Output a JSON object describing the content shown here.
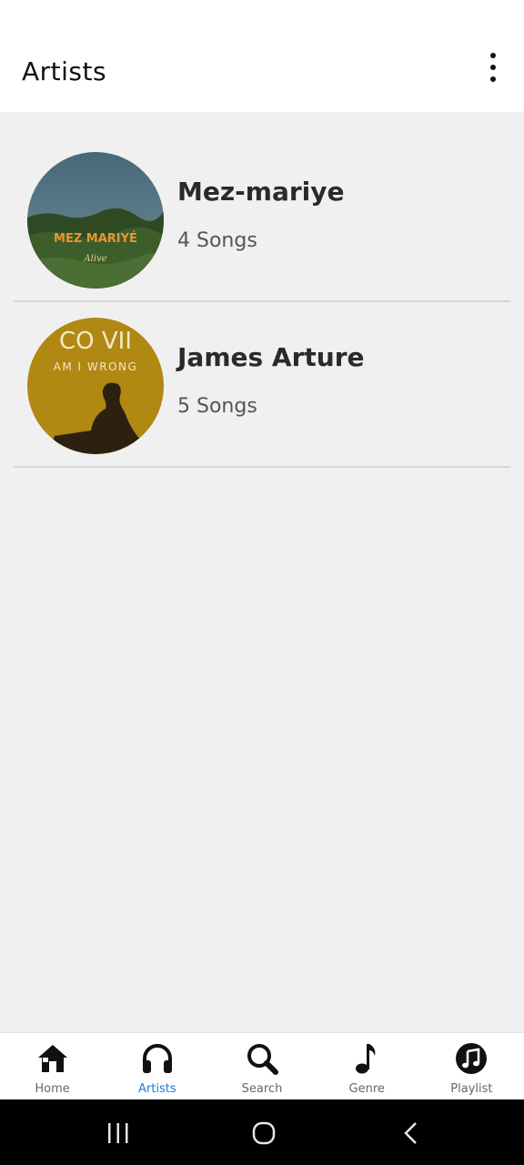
{
  "header": {
    "title": "Artists",
    "menu_icon": "more-vert-icon"
  },
  "artists": [
    {
      "name": "Mez-mariye",
      "songs": "4 Songs",
      "cover_title": "MEZ MARIYÉ",
      "cover_subtitle": "Alive"
    },
    {
      "name": "James Arture",
      "songs": "5 Songs",
      "cover_title": "AM I WRONG",
      "cover_subtitle": "CO VII"
    }
  ],
  "bottom_nav": {
    "items": [
      {
        "label": "Home",
        "icon": "home-icon",
        "active": false
      },
      {
        "label": "Artists",
        "icon": "headphones-icon",
        "active": true
      },
      {
        "label": "Search",
        "icon": "search-icon",
        "active": false
      },
      {
        "label": "Genre",
        "icon": "music-note-icon",
        "active": false
      },
      {
        "label": "Playlist",
        "icon": "music-disc-icon",
        "active": false
      }
    ]
  },
  "system_nav": {
    "recents_icon": "recents-icon",
    "home_icon": "system-home-icon",
    "back_icon": "back-icon"
  },
  "colors": {
    "active": "#1e7bd6",
    "background": "#f0f0f0",
    "navbar": "#000000"
  }
}
